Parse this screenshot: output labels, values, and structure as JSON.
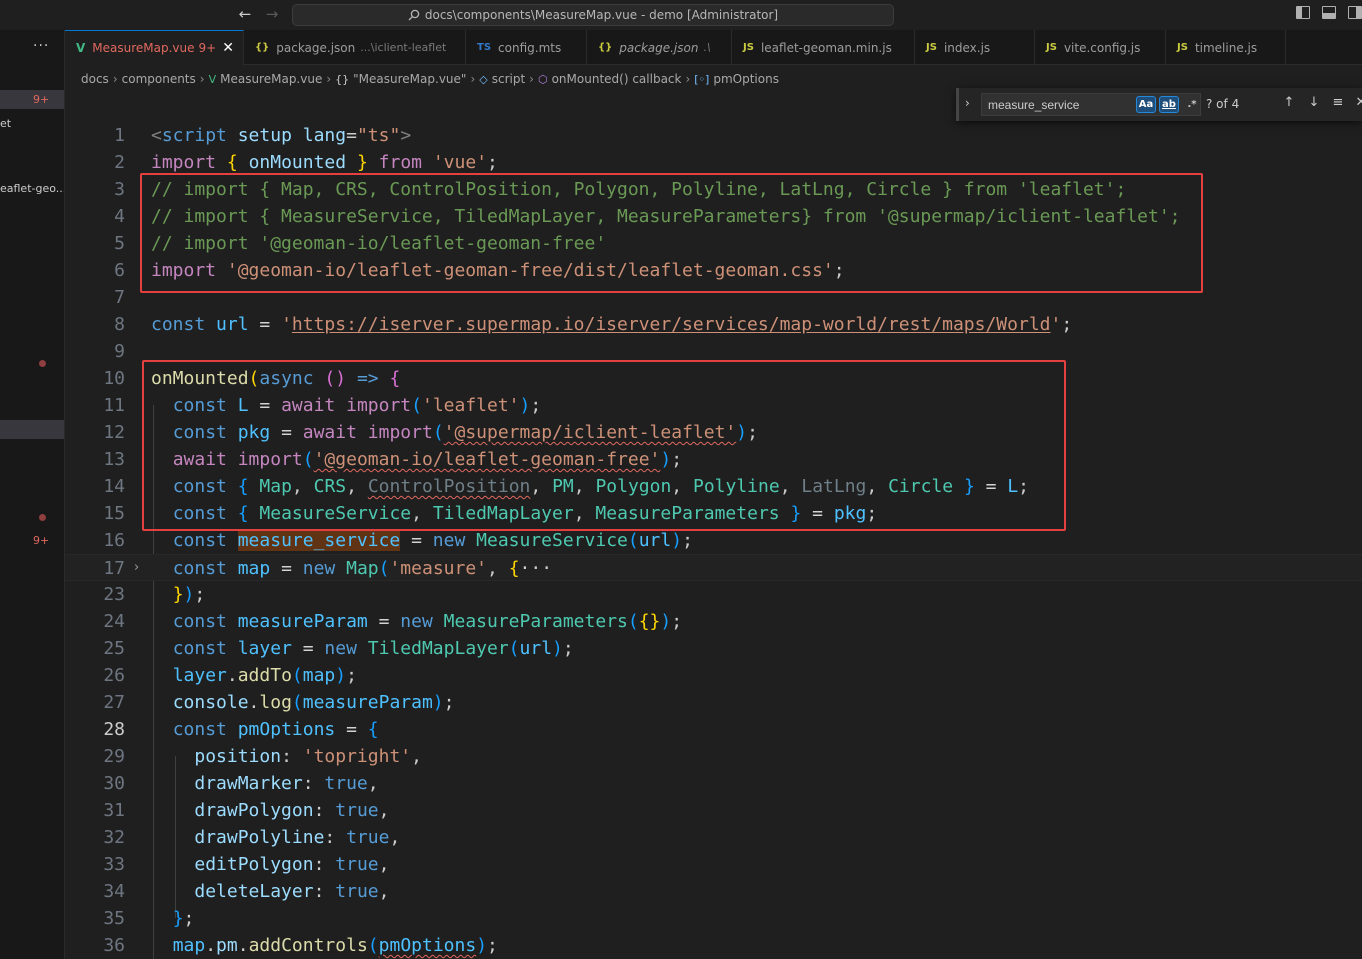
{
  "titlebar": {
    "back_icon": "←",
    "forward_icon": "→",
    "command_center": "docs\\components\\MeasureMap.vue - demo [Administrator]"
  },
  "sidebar": {
    "more": "···",
    "badge_top": "9+",
    "item_text_1": "et",
    "item_text_2": "eaflet-geo...",
    "badge_bottom": "9+"
  },
  "tabs": [
    {
      "label": "MeasureMap.vue",
      "badge": "9+",
      "close": "✕",
      "icon": "V"
    },
    {
      "label": "package.json",
      "desc": "...\\iclient-leaflet",
      "icon": "{}"
    },
    {
      "label": "config.mts",
      "icon": "TS"
    },
    {
      "label": "package.json",
      "desc": ".\\",
      "icon": "{}"
    },
    {
      "label": "leaflet-geoman.min.js",
      "icon": "JS"
    },
    {
      "label": "index.js",
      "icon": "JS"
    },
    {
      "label": "vite.config.js",
      "icon": "JS"
    },
    {
      "label": "timeline.js",
      "icon": "JS"
    }
  ],
  "breadcrumb": [
    "docs",
    "components",
    "MeasureMap.vue",
    "\"MeasureMap.vue\"",
    "script",
    "onMounted() callback",
    "pmOptions"
  ],
  "find": {
    "value": "measure_service",
    "case_label": "Aa",
    "word_label": "ab",
    "regex_label": ".*",
    "count": "? of 4"
  },
  "colors": {
    "accent": "#0078d4",
    "error": "#e0685f",
    "highlight_box": "#e54040",
    "find_match": "#613315"
  },
  "line_numbers": [
    "1",
    "2",
    "3",
    "4",
    "5",
    "6",
    "7",
    "8",
    "9",
    "10",
    "11",
    "12",
    "13",
    "14",
    "15",
    "16",
    "17",
    "23",
    "24",
    "25",
    "26",
    "27",
    "28",
    "29",
    "30",
    "31",
    "32",
    "33",
    "34",
    "35",
    "36"
  ],
  "code": {
    "l1": {
      "lt": "<",
      "tag": "script",
      "a1": "setup",
      "a2": "lang",
      "eq": "=",
      "val": "\"ts\"",
      "gt": ">"
    },
    "l2": {
      "kw": "import",
      "lb": "{",
      "name": "onMounted",
      "rb": "}",
      "from": "from",
      "src": "'vue'",
      "semi": ";"
    },
    "l3": "// import { Map, CRS, ControlPosition, Polygon, Polyline, LatLng, Circle } from 'leaflet';",
    "l4": "// import { MeasureService, TiledMapLayer, MeasureParameters} from '@supermap/iclient-leaflet';",
    "l5": "// import '@geoman-io/leaflet-geoman-free'",
    "l6": {
      "kw": "import",
      "src": "'@geoman-io/leaflet-geoman-free/dist/leaflet-geoman.css'",
      "semi": ";"
    },
    "l8": {
      "kw": "const",
      "name": "url",
      "eq": " = ",
      "q1": "'",
      "url": "https://iserver.supermap.io/iserver/services/map-world/rest/maps/World",
      "q2": "'",
      "semi": ";"
    },
    "l10": {
      "fn": "onMounted",
      "lp": "(",
      "async": "async",
      "args": "()",
      "arrow": "=>",
      "lb": "{"
    },
    "l11": {
      "kw": "const",
      "name": "L",
      "eq": " = ",
      "await": "await",
      "imp": "import",
      "lp": "(",
      "src": "'leaflet'",
      "rp": ")",
      "semi": ";"
    },
    "l12": {
      "kw": "const",
      "name": "pkg",
      "eq": " = ",
      "await": "await",
      "imp": "import",
      "lp": "(",
      "src": "'@supermap/iclient-leaflet'",
      "rp": ")",
      "semi": ";"
    },
    "l13": {
      "await": "await",
      "imp": "import",
      "lp": "(",
      "src": "'@geoman-io/leaflet-geoman-free'",
      "rp": ")",
      "semi": ";"
    },
    "l14": {
      "kw": "const",
      "lb": "{",
      "n1": "Map",
      "n2": "CRS",
      "n3": "ControlPosition",
      "n4": "PM",
      "n5": "Polygon",
      "n6": "Polyline",
      "n7": "LatLng",
      "n8": "Circle",
      "rb": "}",
      "eq": " = ",
      "obj": "L",
      "semi": ";",
      "comma": ", "
    },
    "l15": {
      "kw": "const",
      "lb": "{",
      "n1": "MeasureService",
      "n2": "TiledMapLayer",
      "n3": "MeasureParameters",
      "rb": "}",
      "eq": " = ",
      "obj": "pkg",
      "semi": ";",
      "comma": ", "
    },
    "l16": {
      "kw": "const",
      "name": "measure_service",
      "eq": " = ",
      "new": "new",
      "cls": "MeasureService",
      "lp": "(",
      "arg": "url",
      "rp": ")",
      "semi": ";"
    },
    "l17": {
      "kw": "const",
      "name": "map",
      "eq": " = ",
      "new": "new",
      "cls": "Map",
      "lp": "(",
      "arg": "'measure'",
      "comma": ", ",
      "lb": "{",
      "ellipsis": "···"
    },
    "l23": {
      "rb": "}",
      "rp": ")",
      "semi": ";"
    },
    "l24": {
      "kw": "const",
      "name": "measureParam",
      "eq": " = ",
      "new": "new",
      "cls": "MeasureParameters",
      "lp": "(",
      "obj": "{}",
      "rp": ")",
      "semi": ";"
    },
    "l25": {
      "kw": "const",
      "name": "layer",
      "eq": " = ",
      "new": "new",
      "cls": "TiledMapLayer",
      "lp": "(",
      "arg": "url",
      "rp": ")",
      "semi": ";"
    },
    "l26": {
      "obj": "layer",
      "dot": ".",
      "fn": "addTo",
      "lp": "(",
      "arg": "map",
      "rp": ")",
      "semi": ";"
    },
    "l27": {
      "obj": "console",
      "dot": ".",
      "fn": "log",
      "lp": "(",
      "arg": "measureParam",
      "rp": ")",
      "semi": ";"
    },
    "l28": {
      "kw": "const",
      "name": "pmOptions",
      "eq": " = ",
      "lb": "{"
    },
    "l29": {
      "key": "position",
      "colon": ": ",
      "val": "'topright'",
      "comma": ","
    },
    "l30": {
      "key": "drawMarker",
      "colon": ": ",
      "val": "true",
      "comma": ","
    },
    "l31": {
      "key": "drawPolygon",
      "colon": ": ",
      "val": "true",
      "comma": ","
    },
    "l32": {
      "key": "drawPolyline",
      "colon": ": ",
      "val": "true",
      "comma": ","
    },
    "l33": {
      "key": "editPolygon",
      "colon": ": ",
      "val": "true",
      "comma": ","
    },
    "l34": {
      "key": "deleteLayer",
      "colon": ": ",
      "val": "true",
      "comma": ","
    },
    "l35": {
      "rb": "}",
      "semi": ";"
    },
    "l36": {
      "obj": "map",
      "dot": ".",
      "prop": "pm",
      "dot2": ".",
      "fn": "addControls",
      "lp": "(",
      "arg": "pmOptions",
      "rp": ")",
      "semi": ";"
    }
  }
}
